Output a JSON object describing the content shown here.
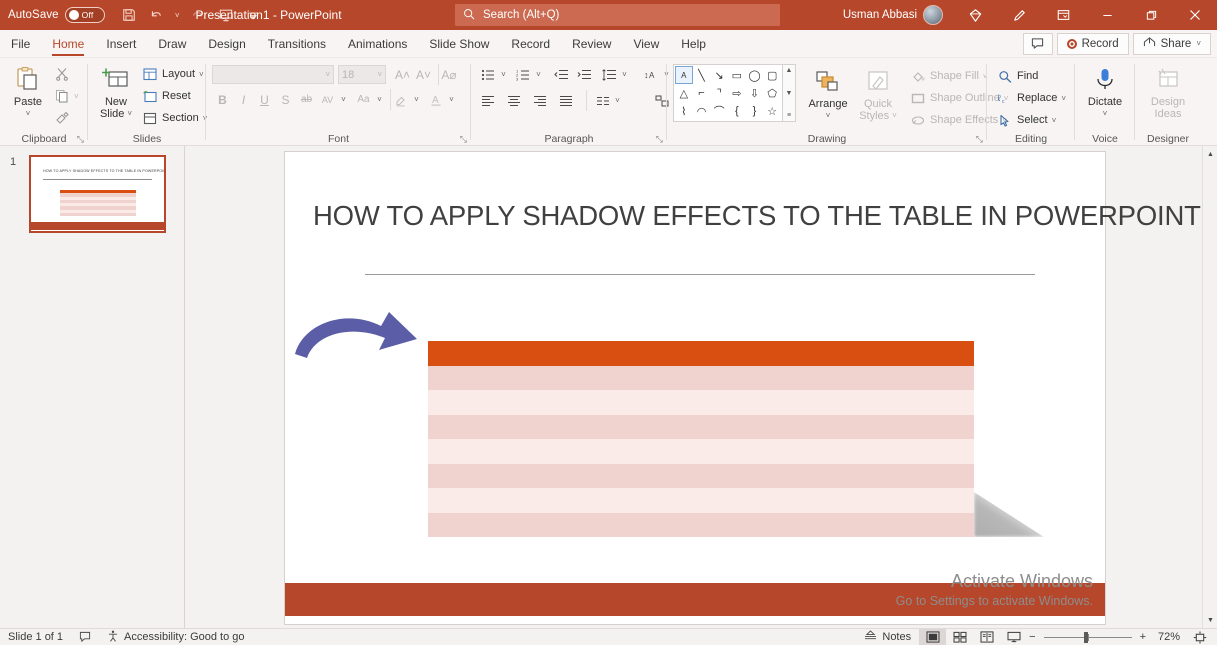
{
  "titlebar": {
    "autosave_label": "AutoSave",
    "autosave_state": "Off",
    "document_title": "Presentation1",
    "app_name": "PowerPoint",
    "title_full": "Presentation1  -  PowerPoint",
    "icons": [
      "save-icon",
      "undo-icon",
      "undo-dropdown-icon",
      "redo-icon",
      "start-presentation-icon",
      "customize-quick-access-toolbar-icon"
    ],
    "search_placeholder": "Search (Alt+Q)",
    "search_icon": "search-icon",
    "user_name": "Usman Abbasi",
    "diamond_icon": "microsoft-365-diamond-icon",
    "pen_icon": "pen-feedback-icon",
    "ribbon_display_icon": "ribbon-display-options-icon",
    "minimize_icon": "minimize-icon",
    "restore_icon": "restore-icon",
    "close_icon": "close-icon",
    "background_color": "#b7472a"
  },
  "tabs": [
    {
      "label": "File",
      "active": false
    },
    {
      "label": "Home",
      "active": true
    },
    {
      "label": "Insert",
      "active": false
    },
    {
      "label": "Draw",
      "active": false
    },
    {
      "label": "Design",
      "active": false
    },
    {
      "label": "Transitions",
      "active": false
    },
    {
      "label": "Animations",
      "active": false
    },
    {
      "label": "Slide Show",
      "active": false
    },
    {
      "label": "Record",
      "active": false
    },
    {
      "label": "Review",
      "active": false
    },
    {
      "label": "View",
      "active": false
    },
    {
      "label": "Help",
      "active": false
    }
  ],
  "tab_actions": {
    "comments_icon": "comments-icon",
    "record_label": "Record",
    "share_label": "Share",
    "share_icon": "share-icon",
    "share_caret": "˅"
  },
  "ribbon": {
    "collapse_icon": "collapse-ribbon-icon",
    "groups": [
      {
        "name": "clipboard",
        "label": "Clipboard",
        "has_dialog_launcher": true,
        "paste_label": "Paste",
        "paste_caret": "˅",
        "items": [
          "cut-icon",
          "copy-icon",
          "format-painter-icon"
        ]
      },
      {
        "name": "slides",
        "label": "Slides",
        "has_dialog_launcher": false,
        "new_slide_label_line1": "New",
        "new_slide_label_line2": "Slide",
        "layout_label": "Layout",
        "reset_label": "Reset",
        "section_label": "Section"
      },
      {
        "name": "font",
        "label": "Font",
        "has_dialog_launcher": true,
        "disabled": true,
        "font_name_value": "",
        "font_size_value": "18",
        "buttons": [
          "increase-font-size-icon",
          "decrease-font-size-icon",
          "clear-formatting-icon",
          "bold-icon",
          "italic-icon",
          "underline-icon",
          "text-shadow-icon",
          "strikethrough-icon",
          "character-spacing-icon",
          "change-case-icon",
          "text-highlight-color-icon",
          "font-color-icon"
        ],
        "bold": "B",
        "italic": "I",
        "underline": "U",
        "shadow": "S",
        "strikethrough": "ab",
        "spacing": "AV",
        "case": "Aa"
      },
      {
        "name": "paragraph",
        "label": "Paragraph",
        "has_dialog_launcher": true,
        "buttons": [
          "bullets-icon",
          "numbering-icon",
          "decrease-indent-icon",
          "increase-indent-icon",
          "line-spacing-icon",
          "text-direction-icon",
          "align-text-icon",
          "convert-to-smartart-icon",
          "align-left-icon",
          "align-center-icon",
          "align-right-icon",
          "justify-icon",
          "columns-icon"
        ]
      },
      {
        "name": "drawing",
        "label": "Drawing",
        "has_dialog_launcher": true,
        "arrange_label": "Arrange",
        "quick_styles_label_line1": "Quick",
        "quick_styles_label_line2": "Styles",
        "shape_fill_label": "Shape Fill",
        "shape_outline_label": "Shape Outline",
        "shape_effects_label": "Shape Effects",
        "shapes": [
          "A",
          "╲",
          "↘",
          "▭",
          "◯",
          "▢",
          "△",
          "⌐",
          "⌙",
          "⇒",
          "⇓",
          "◗",
          "⌇",
          "◠",
          "⌒",
          "{",
          "}",
          "☆"
        ]
      },
      {
        "name": "editing",
        "label": "Editing",
        "has_dialog_launcher": false,
        "find_label": "Find",
        "replace_label": "Replace",
        "select_label": "Select"
      },
      {
        "name": "voice",
        "label": "Voice",
        "has_dialog_launcher": false,
        "dictate_label": "Dictate",
        "dictate_caret": "˅"
      },
      {
        "name": "designer",
        "label": "Designer",
        "has_dialog_launcher": false,
        "disabled": true,
        "design_ideas_line1": "Design",
        "design_ideas_line2": "Ideas"
      }
    ]
  },
  "thumbnail_pane": {
    "slide_number": "1",
    "thumb_title": "HOW TO APPLY SHADOW EFFECTS TO THE TABLE IN POWERPOINT"
  },
  "slide": {
    "title": "HOW TO APPLY SHADOW EFFECTS TO THE TABLE IN POWERPOINT",
    "accent_color": "#d94f12",
    "bottom_bar_color": "#b7472a",
    "table": {
      "header_color": "#d94f12",
      "band_dark": "#f0d3ce",
      "band_light": "#faeae8",
      "row_count": 8,
      "rows": [
        "header",
        "dark",
        "light",
        "dark",
        "light",
        "dark",
        "light",
        "dark"
      ]
    },
    "arrow": {
      "name": "curved-arrow-shape",
      "color": "#5b5ea6"
    },
    "shadow": {
      "name": "perspective-shadow",
      "color": "#808080"
    }
  },
  "watermark": {
    "line1": "Activate Windows",
    "line2": "Go to Settings to activate Windows."
  },
  "statusbar": {
    "slide_counter": "Slide 1 of 1",
    "notes_page_icon": "notes-page-icon",
    "accessibility_icon": "accessibility-icon",
    "accessibility_label": "Accessibility: Good to go",
    "notes_label": "Notes",
    "views": [
      "normal-view-icon",
      "slide-sorter-view-icon",
      "reading-view-icon",
      "slide-show-view-icon"
    ],
    "zoom_out": "−",
    "zoom_in": "+",
    "zoom_level": "72%",
    "fit_icon": "fit-slide-to-window-icon"
  }
}
